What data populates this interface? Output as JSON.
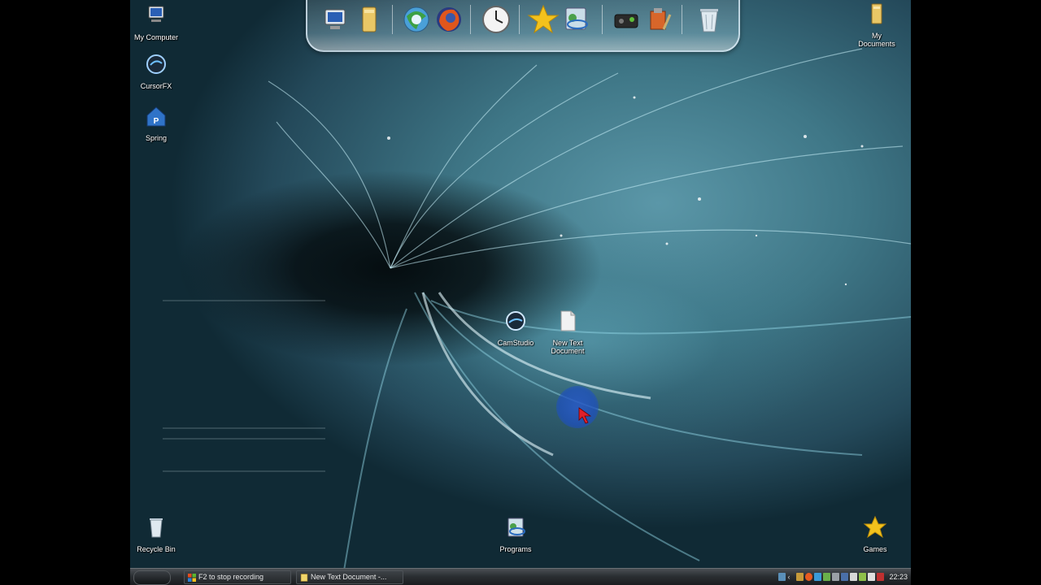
{
  "desktop": {
    "icons_left": [
      {
        "label": "My Computer",
        "icon": "computer-icon"
      },
      {
        "label": "CursorFX",
        "icon": "cursorfx-icon"
      },
      {
        "label": "Spring",
        "icon": "spring-icon"
      }
    ],
    "icons_right": [
      {
        "label": "My Documents",
        "icon": "folder-icon"
      }
    ],
    "icons_center": [
      {
        "label": "CamStudio",
        "icon": "camstudio-icon"
      },
      {
        "label": "New Text Document",
        "icon": "text-document-icon"
      }
    ],
    "icons_bottom": [
      {
        "label": "Recycle Bin",
        "icon": "recycle-bin-icon"
      },
      {
        "label": "Programs",
        "icon": "programs-icon"
      },
      {
        "label": "Games",
        "icon": "star-icon"
      }
    ]
  },
  "dock": {
    "items": [
      "computer-icon",
      "documents-icon",
      "browser-icon",
      "firefox-icon",
      "clock-icon",
      "favorites-star-icon",
      "media-icon",
      "games-icon",
      "tools-icon",
      "recycle-bin-icon"
    ]
  },
  "taskbar": {
    "buttons": [
      {
        "label": "F2 to stop recording",
        "icon": "windows-icon"
      },
      {
        "label": "New Text Document -...",
        "icon": "notepad-icon"
      }
    ],
    "clock": "22:23"
  },
  "colors": {
    "taskbar": "#2b2f33",
    "wallpaper_teal": "#3f7787",
    "cursor_halo": "#2a5ac8",
    "cursor": "#e0202a"
  }
}
